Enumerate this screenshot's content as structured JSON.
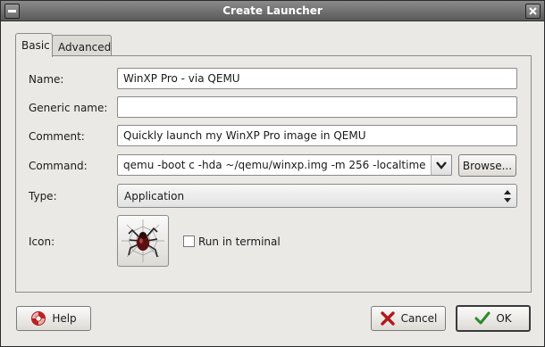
{
  "window": {
    "title": "Create Launcher"
  },
  "tabs": [
    {
      "label": "Basic"
    },
    {
      "label": "Advanced"
    }
  ],
  "form": {
    "name": {
      "label": "Name:",
      "value": "WinXP Pro - via QEMU"
    },
    "generic_name": {
      "label": "Generic name:",
      "value": ""
    },
    "comment": {
      "label": "Comment:",
      "value": "Quickly launch my WinXP Pro image in QEMU"
    },
    "command": {
      "label": "Command:",
      "value": "qemu -boot c -hda ~/qemu/winxp.img -m 256 -localtime",
      "browse_label": "Browse..."
    },
    "type": {
      "label": "Type:",
      "value": "Application"
    },
    "icon": {
      "label": "Icon:"
    },
    "run_in_terminal": {
      "label": "Run in terminal",
      "checked": false
    }
  },
  "buttons": {
    "help": "Help",
    "cancel": "Cancel",
    "ok": "OK"
  },
  "icons": {
    "close": "close-icon",
    "help": "help-lifebuoy-icon",
    "cancel": "cancel-x-icon",
    "ok": "ok-check-icon",
    "launcher": "spider-web-icon"
  }
}
